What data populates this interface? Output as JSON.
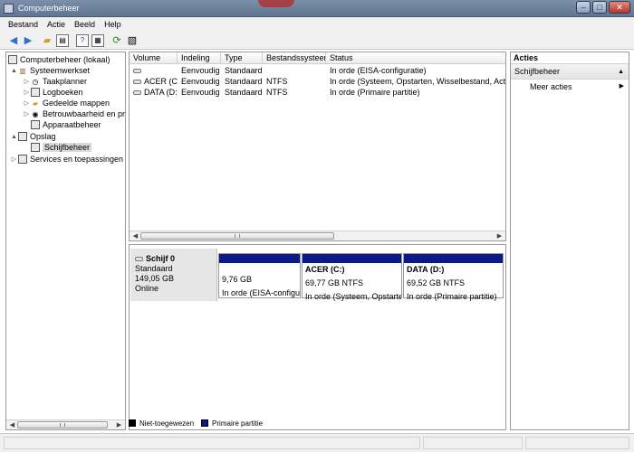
{
  "window": {
    "title": "Computerbeheer",
    "buttons": [
      "–",
      "□",
      "✕"
    ]
  },
  "menu": [
    "Bestand",
    "Actie",
    "Beeld",
    "Help"
  ],
  "toolbar": {
    "icons": [
      "back-icon",
      "forward-icon",
      "up-folder-icon",
      "console-tree-icon",
      "help-icon",
      "properties-icon",
      "refresh-icon",
      "export-icon"
    ]
  },
  "tree": {
    "root": "Computerbeheer (lokaal)",
    "systeemwerkset": "Systeemwerkset",
    "taakplanner": "Taakplanner",
    "logboeken": "Logboeken",
    "gedeelde_mappen": "Gedeelde mappen",
    "betrouwbaarheid": "Betrouwbaarheid en pre",
    "apparaatbeheer": "Apparaatbeheer",
    "opslag": "Opslag",
    "schijfbeheer": "Schijfbeheer",
    "services": "Services en toepassingen"
  },
  "volume_table": {
    "columns": [
      "Volume",
      "Indeling",
      "Type",
      "Bestandssysteem",
      "Status"
    ],
    "rows": [
      [
        "",
        "Eenvoudig",
        "Standaard",
        "",
        "In orde (EISA-configuratie)"
      ],
      [
        "ACER (C:)",
        "Eenvoudig",
        "Standaard",
        "NTFS",
        "In orde (Systeem, Opstarten, Wisselbestand, Actief, C"
      ],
      [
        "DATA (D:)",
        "Eenvoudig",
        "Standaard",
        "NTFS",
        "In orde (Primaire partitie)"
      ]
    ]
  },
  "disk": {
    "name": "Schijf 0",
    "type": "Standaard",
    "size": "149,05 GB",
    "state": "Online",
    "partitions": [
      {
        "label": "",
        "size": "9,76 GB",
        "status": "In orde (EISA-configur"
      },
      {
        "label": "ACER  (C:)",
        "size": "69,77 GB NTFS",
        "status": "In orde (Systeem, Opstarter"
      },
      {
        "label": "DATA  (D:)",
        "size": "69,52 GB NTFS",
        "status": "In orde (Primaire partitie)"
      }
    ]
  },
  "legend": [
    {
      "label": "Niet-toegewezen",
      "color": "#000000"
    },
    {
      "label": "Primaire partitie",
      "color": "#0a1a8a"
    }
  ],
  "actions": {
    "title": "Acties",
    "section": "Schijfbeheer",
    "more": "Meer acties"
  }
}
